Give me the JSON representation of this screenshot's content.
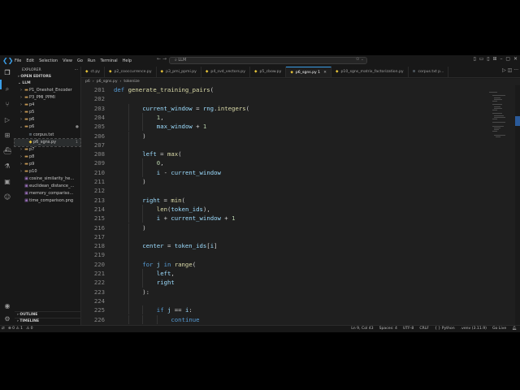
{
  "titlebar": {
    "menu": [
      "File",
      "Edit",
      "Selection",
      "View",
      "Go",
      "Run",
      "Terminal",
      "Help"
    ],
    "search_text": "LLM"
  },
  "sidebar": {
    "header": "EXPLORER",
    "open_editors": "OPEN EDITORS",
    "root": "LLM",
    "tree": [
      {
        "depth": 1,
        "chev": "›",
        "type": "folder",
        "name": "P1_Oneshot_Encoder",
        "mark": ""
      },
      {
        "depth": 1,
        "chev": "›",
        "type": "folder",
        "name": "P3_PMI_PPMI",
        "mark": ""
      },
      {
        "depth": 1,
        "chev": "›",
        "type": "folder",
        "name": "p4",
        "mark": ""
      },
      {
        "depth": 1,
        "chev": "›",
        "type": "folder",
        "name": "p5",
        "mark": ""
      },
      {
        "depth": 1,
        "chev": "›",
        "type": "folder",
        "name": "p6",
        "mark": ""
      },
      {
        "depth": 1,
        "chev": "⌄",
        "type": "folder",
        "name": "p6",
        "mark": "●"
      },
      {
        "depth": 2,
        "chev": "",
        "type": "txt",
        "name": "corpus.txt",
        "mark": ""
      },
      {
        "depth": 2,
        "chev": "",
        "type": "py",
        "name": "p6_sgns.py",
        "mark": "1",
        "selected": true
      },
      {
        "depth": 1,
        "chev": "›",
        "type": "folder",
        "name": "p7",
        "mark": ""
      },
      {
        "depth": 1,
        "chev": "›",
        "type": "folder",
        "name": "p8",
        "mark": ""
      },
      {
        "depth": 1,
        "chev": "›",
        "type": "folder",
        "name": "p9",
        "mark": ""
      },
      {
        "depth": 1,
        "chev": "›",
        "type": "folder",
        "name": "p10",
        "mark": ""
      },
      {
        "depth": 1,
        "chev": "",
        "type": "png",
        "name": "cosine_similarity_heat...",
        "mark": ""
      },
      {
        "depth": 1,
        "chev": "",
        "type": "png",
        "name": "euclidean_distance_he...",
        "mark": ""
      },
      {
        "depth": 1,
        "chev": "",
        "type": "png",
        "name": "memory_comparison.p...",
        "mark": ""
      },
      {
        "depth": 1,
        "chev": "",
        "type": "png",
        "name": "time_comparison.png",
        "mark": ""
      }
    ],
    "outline": "OUTLINE",
    "timeline": "TIMELINE"
  },
  "tabs": [
    {
      "label": "ct.py",
      "icon": "py",
      "active": false
    },
    {
      "label": "p2_cooccurrence.py",
      "icon": "py",
      "active": false
    },
    {
      "label": "p3_pmi_ppmi.py",
      "icon": "py",
      "active": false
    },
    {
      "label": "p4_svd_vectors.py",
      "icon": "py",
      "active": false
    },
    {
      "label": "p5_cbow.py",
      "icon": "py",
      "active": false
    },
    {
      "label": "p6_sgns.py 1",
      "icon": "py",
      "active": true
    },
    {
      "label": "p10_sgns_matrix_factorization.py",
      "icon": "py",
      "active": false
    },
    {
      "label": "corpus.txt p...",
      "icon": "txt",
      "active": false
    }
  ],
  "breadcrumb": [
    "p6",
    "›",
    "p6_sgns.py",
    "›",
    "tokenize"
  ],
  "code": [
    {
      "n": "201",
      "indent": 0,
      "tokens": [
        [
          "kw",
          "def "
        ],
        [
          "fn",
          "generate_training_pairs"
        ],
        [
          "",
          "("
        ]
      ]
    },
    {
      "n": "202",
      "indent": 1,
      "tokens": []
    },
    {
      "n": "203",
      "indent": 2,
      "tokens": [
        [
          "var",
          "current_window"
        ],
        [
          "",
          " = "
        ],
        [
          "var",
          "rng"
        ],
        [
          "",
          "."
        ],
        [
          "fn",
          "integers"
        ],
        [
          "",
          "("
        ]
      ]
    },
    {
      "n": "204",
      "indent": 3,
      "tokens": [
        [
          "num",
          "1"
        ],
        [
          "",
          ","
        ]
      ]
    },
    {
      "n": "205",
      "indent": 3,
      "tokens": [
        [
          "var",
          "max_window"
        ],
        [
          "",
          " + "
        ],
        [
          "num",
          "1"
        ]
      ]
    },
    {
      "n": "206",
      "indent": 2,
      "tokens": [
        [
          "",
          ")"
        ]
      ]
    },
    {
      "n": "207",
      "indent": 2,
      "tokens": []
    },
    {
      "n": "208",
      "indent": 2,
      "tokens": [
        [
          "var",
          "left"
        ],
        [
          "",
          " = "
        ],
        [
          "fn",
          "max"
        ],
        [
          "",
          "("
        ]
      ]
    },
    {
      "n": "209",
      "indent": 3,
      "tokens": [
        [
          "num",
          "0"
        ],
        [
          "",
          ","
        ]
      ]
    },
    {
      "n": "210",
      "indent": 3,
      "tokens": [
        [
          "var",
          "i"
        ],
        [
          "",
          " - "
        ],
        [
          "var",
          "current_window"
        ]
      ]
    },
    {
      "n": "211",
      "indent": 2,
      "tokens": [
        [
          "",
          ")"
        ]
      ]
    },
    {
      "n": "212",
      "indent": 2,
      "tokens": []
    },
    {
      "n": "213",
      "indent": 2,
      "tokens": [
        [
          "var",
          "right"
        ],
        [
          "",
          " = "
        ],
        [
          "fn",
          "min"
        ],
        [
          "",
          "("
        ]
      ]
    },
    {
      "n": "214",
      "indent": 3,
      "tokens": [
        [
          "fn",
          "len"
        ],
        [
          "",
          "("
        ],
        [
          "var",
          "token_ids"
        ],
        [
          "",
          "),"
        ]
      ]
    },
    {
      "n": "215",
      "indent": 3,
      "tokens": [
        [
          "var",
          "i"
        ],
        [
          "",
          " + "
        ],
        [
          "var",
          "current_window"
        ],
        [
          "",
          " + "
        ],
        [
          "num",
          "1"
        ]
      ]
    },
    {
      "n": "216",
      "indent": 2,
      "tokens": [
        [
          "",
          ")"
        ]
      ]
    },
    {
      "n": "217",
      "indent": 2,
      "tokens": []
    },
    {
      "n": "218",
      "indent": 2,
      "tokens": [
        [
          "var",
          "center"
        ],
        [
          "",
          " = "
        ],
        [
          "var",
          "token_ids"
        ],
        [
          "",
          "["
        ],
        [
          "var",
          "i"
        ],
        [
          "",
          "]"
        ]
      ]
    },
    {
      "n": "219",
      "indent": 2,
      "tokens": []
    },
    {
      "n": "220",
      "indent": 2,
      "tokens": [
        [
          "kw",
          "for "
        ],
        [
          "var",
          "j"
        ],
        [
          "kw",
          " in "
        ],
        [
          "fn",
          "range"
        ],
        [
          "",
          "("
        ]
      ]
    },
    {
      "n": "221",
      "indent": 3,
      "tokens": [
        [
          "var",
          "left"
        ],
        [
          "",
          ","
        ]
      ]
    },
    {
      "n": "222",
      "indent": 3,
      "tokens": [
        [
          "var",
          "right"
        ]
      ]
    },
    {
      "n": "223",
      "indent": 2,
      "tokens": [
        [
          "",
          "):"
        ]
      ]
    },
    {
      "n": "224",
      "indent": 2,
      "tokens": []
    },
    {
      "n": "225",
      "indent": 3,
      "tokens": [
        [
          "kw",
          "if "
        ],
        [
          "var",
          "j"
        ],
        [
          "",
          " == "
        ],
        [
          "var",
          "i"
        ],
        [
          "",
          ":"
        ]
      ]
    },
    {
      "n": "226",
      "indent": 4,
      "tokens": [
        [
          "kw",
          "continue"
        ]
      ]
    }
  ],
  "status": {
    "left": [
      "⊗ 0  ⚠ 1",
      "⚠ 0"
    ],
    "right": [
      "Ln 9, Col 43",
      "Spaces: 4",
      "UTF-8",
      "CRLF",
      "{ } Python",
      ".venv (3.11.9)",
      "Go Live"
    ]
  }
}
